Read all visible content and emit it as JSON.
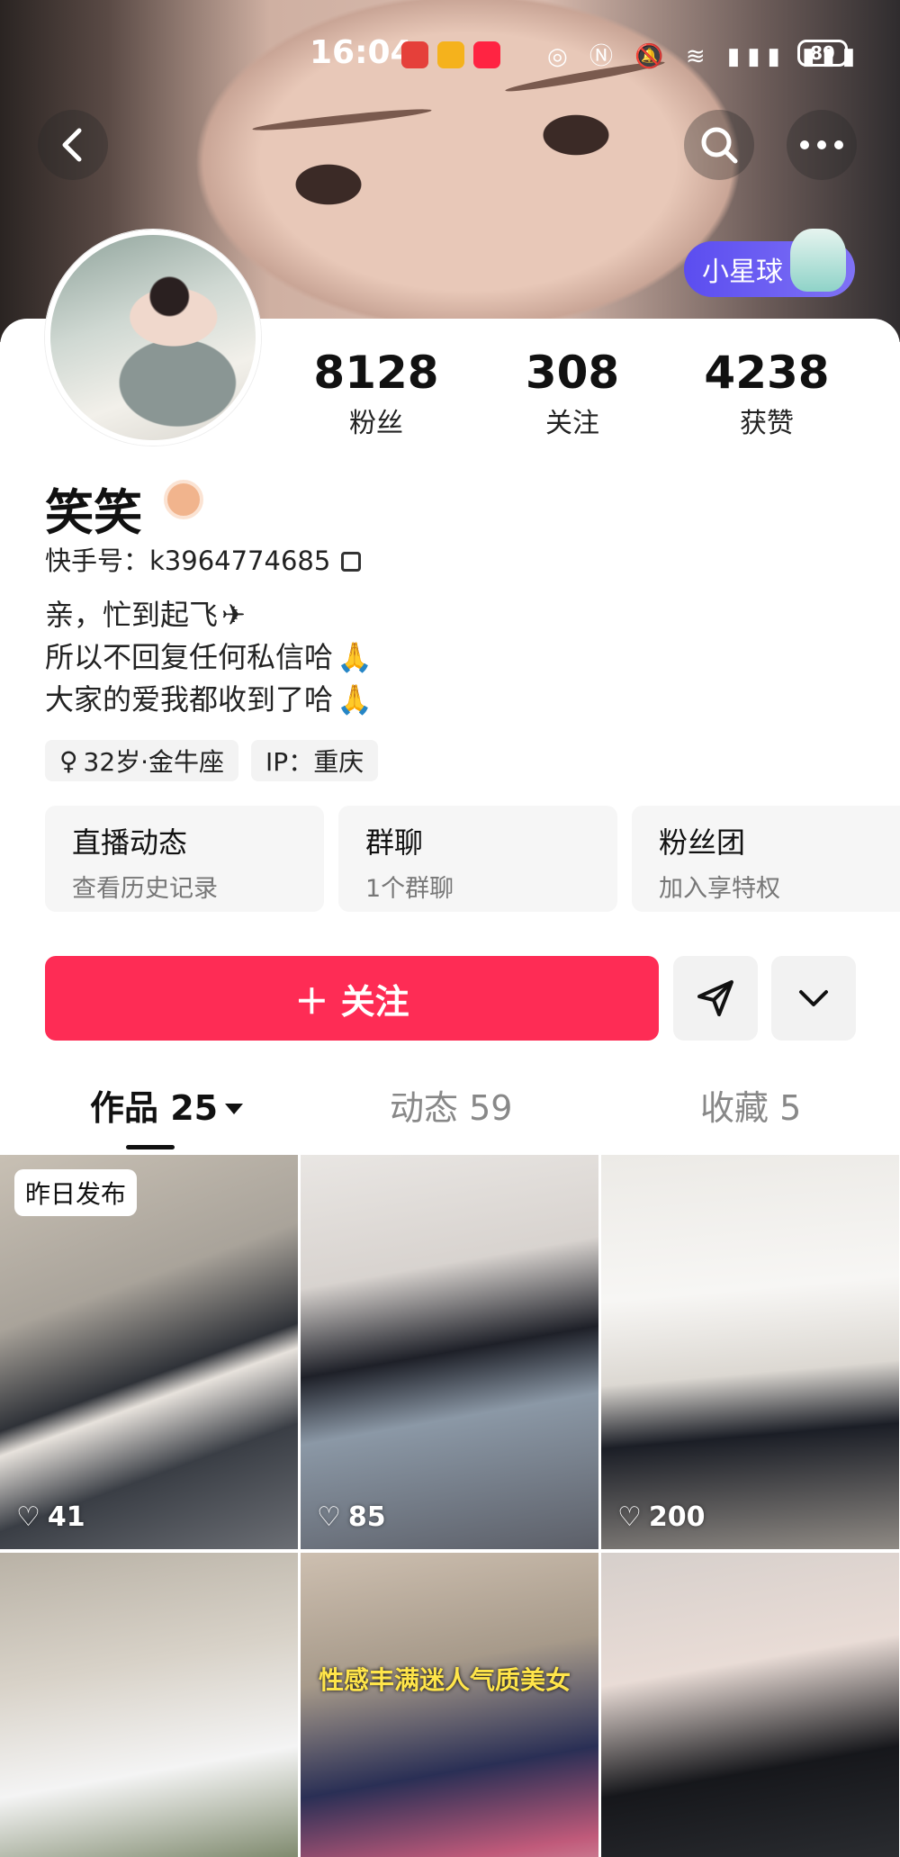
{
  "status_bar": {
    "time": "16:04",
    "battery": "89",
    "icons": [
      "huawei-app",
      "weibo-app",
      "xiaohongshu-app",
      "nfc",
      "mute",
      "wifi",
      "4g-signal",
      "5g-signal"
    ]
  },
  "header": {
    "back_icon": "chevron-left-icon",
    "search_icon": "search-icon",
    "more_icon": "more-icon",
    "star_planet_label": "小星球"
  },
  "profile": {
    "name": "笑笑",
    "kuaishou_id": "快手号：k3964774685",
    "bio": [
      "亲，忙到起飞",
      "所以不回复任何私信哈",
      "大家的爱我都收到了哈"
    ],
    "tags": [
      "32岁·金牛座",
      "IP：重庆"
    ]
  },
  "stats": [
    {
      "value": "8128",
      "label": "粉丝"
    },
    {
      "value": "308",
      "label": "关注"
    },
    {
      "value": "4238",
      "label": "获赞"
    }
  ],
  "feature_cards": [
    {
      "title": "直播动态",
      "subtitle": "查看历史记录"
    },
    {
      "title": "群聊",
      "subtitle": "1个群聊"
    },
    {
      "title": "粉丝团",
      "subtitle": "加入享特权"
    }
  ],
  "actions": {
    "follow_label": "＋ 关注"
  },
  "tabs": [
    {
      "label": "作品 25",
      "active": true
    },
    {
      "label": "动态 59",
      "active": false
    },
    {
      "label": "收藏 5",
      "active": false
    }
  ],
  "videos": [
    {
      "likes": "41",
      "badge": "昨日发布"
    },
    {
      "likes": "85"
    },
    {
      "likes": "200"
    },
    {
      "likes": ""
    },
    {
      "likes": "",
      "caption": "性感丰满迷人气质美女"
    },
    {
      "likes": ""
    }
  ],
  "colors": {
    "follow_button": "#fe2c55",
    "star_pill": "#5b4df0"
  }
}
